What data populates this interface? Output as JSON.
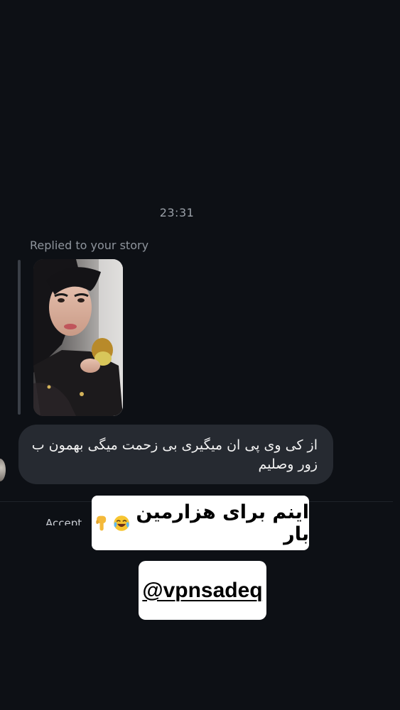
{
  "chat": {
    "timestamp": "23:31",
    "replied_label": "Replied to your story",
    "message_text": "از کی وی پی ان میگیری بی زحمت میگی بهمون ب زور وصلیم",
    "partial_hidden_text": "Accept"
  },
  "overlay": {
    "caption_text": "اینم برای هزارمین بار",
    "caption_emojis": [
      "face-with-tears-of-joy-emoji",
      "backhand-index-pointing-down-emoji"
    ],
    "handle_text": "@vpnsadeq"
  },
  "colors": {
    "background": "#0d1015",
    "bubble": "#262a31",
    "sticker": "#ffffff",
    "muted_text": "#8e949c"
  }
}
